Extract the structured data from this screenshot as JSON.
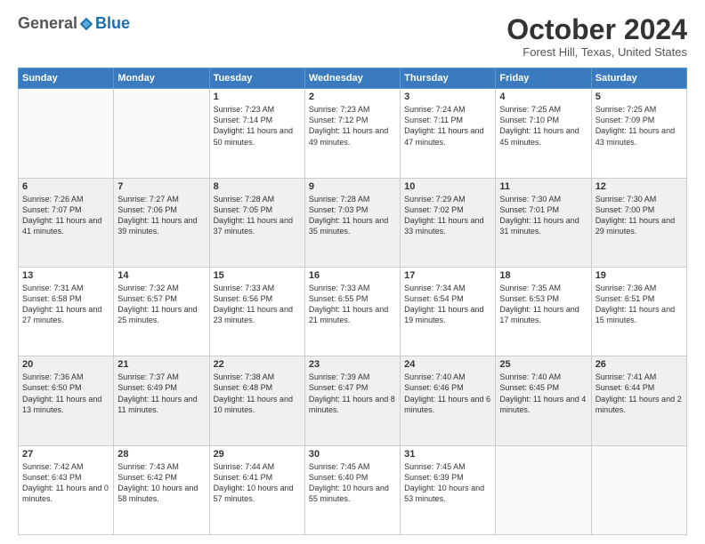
{
  "header": {
    "logo": {
      "general": "General",
      "blue": "Blue"
    },
    "title": "October 2024",
    "location": "Forest Hill, Texas, United States"
  },
  "days_of_week": [
    "Sunday",
    "Monday",
    "Tuesday",
    "Wednesday",
    "Thursday",
    "Friday",
    "Saturday"
  ],
  "weeks": [
    [
      {
        "day": "",
        "empty": true
      },
      {
        "day": "",
        "empty": true
      },
      {
        "day": "1",
        "sunrise": "Sunrise: 7:23 AM",
        "sunset": "Sunset: 7:14 PM",
        "daylight": "Daylight: 11 hours and 50 minutes."
      },
      {
        "day": "2",
        "sunrise": "Sunrise: 7:23 AM",
        "sunset": "Sunset: 7:12 PM",
        "daylight": "Daylight: 11 hours and 49 minutes."
      },
      {
        "day": "3",
        "sunrise": "Sunrise: 7:24 AM",
        "sunset": "Sunset: 7:11 PM",
        "daylight": "Daylight: 11 hours and 47 minutes."
      },
      {
        "day": "4",
        "sunrise": "Sunrise: 7:25 AM",
        "sunset": "Sunset: 7:10 PM",
        "daylight": "Daylight: 11 hours and 45 minutes."
      },
      {
        "day": "5",
        "sunrise": "Sunrise: 7:25 AM",
        "sunset": "Sunset: 7:09 PM",
        "daylight": "Daylight: 11 hours and 43 minutes."
      }
    ],
    [
      {
        "day": "6",
        "sunrise": "Sunrise: 7:26 AM",
        "sunset": "Sunset: 7:07 PM",
        "daylight": "Daylight: 11 hours and 41 minutes."
      },
      {
        "day": "7",
        "sunrise": "Sunrise: 7:27 AM",
        "sunset": "Sunset: 7:06 PM",
        "daylight": "Daylight: 11 hours and 39 minutes."
      },
      {
        "day": "8",
        "sunrise": "Sunrise: 7:28 AM",
        "sunset": "Sunset: 7:05 PM",
        "daylight": "Daylight: 11 hours and 37 minutes."
      },
      {
        "day": "9",
        "sunrise": "Sunrise: 7:28 AM",
        "sunset": "Sunset: 7:03 PM",
        "daylight": "Daylight: 11 hours and 35 minutes."
      },
      {
        "day": "10",
        "sunrise": "Sunrise: 7:29 AM",
        "sunset": "Sunset: 7:02 PM",
        "daylight": "Daylight: 11 hours and 33 minutes."
      },
      {
        "day": "11",
        "sunrise": "Sunrise: 7:30 AM",
        "sunset": "Sunset: 7:01 PM",
        "daylight": "Daylight: 11 hours and 31 minutes."
      },
      {
        "day": "12",
        "sunrise": "Sunrise: 7:30 AM",
        "sunset": "Sunset: 7:00 PM",
        "daylight": "Daylight: 11 hours and 29 minutes."
      }
    ],
    [
      {
        "day": "13",
        "sunrise": "Sunrise: 7:31 AM",
        "sunset": "Sunset: 6:58 PM",
        "daylight": "Daylight: 11 hours and 27 minutes."
      },
      {
        "day": "14",
        "sunrise": "Sunrise: 7:32 AM",
        "sunset": "Sunset: 6:57 PM",
        "daylight": "Daylight: 11 hours and 25 minutes."
      },
      {
        "day": "15",
        "sunrise": "Sunrise: 7:33 AM",
        "sunset": "Sunset: 6:56 PM",
        "daylight": "Daylight: 11 hours and 23 minutes."
      },
      {
        "day": "16",
        "sunrise": "Sunrise: 7:33 AM",
        "sunset": "Sunset: 6:55 PM",
        "daylight": "Daylight: 11 hours and 21 minutes."
      },
      {
        "day": "17",
        "sunrise": "Sunrise: 7:34 AM",
        "sunset": "Sunset: 6:54 PM",
        "daylight": "Daylight: 11 hours and 19 minutes."
      },
      {
        "day": "18",
        "sunrise": "Sunrise: 7:35 AM",
        "sunset": "Sunset: 6:53 PM",
        "daylight": "Daylight: 11 hours and 17 minutes."
      },
      {
        "day": "19",
        "sunrise": "Sunrise: 7:36 AM",
        "sunset": "Sunset: 6:51 PM",
        "daylight": "Daylight: 11 hours and 15 minutes."
      }
    ],
    [
      {
        "day": "20",
        "sunrise": "Sunrise: 7:36 AM",
        "sunset": "Sunset: 6:50 PM",
        "daylight": "Daylight: 11 hours and 13 minutes."
      },
      {
        "day": "21",
        "sunrise": "Sunrise: 7:37 AM",
        "sunset": "Sunset: 6:49 PM",
        "daylight": "Daylight: 11 hours and 11 minutes."
      },
      {
        "day": "22",
        "sunrise": "Sunrise: 7:38 AM",
        "sunset": "Sunset: 6:48 PM",
        "daylight": "Daylight: 11 hours and 10 minutes."
      },
      {
        "day": "23",
        "sunrise": "Sunrise: 7:39 AM",
        "sunset": "Sunset: 6:47 PM",
        "daylight": "Daylight: 11 hours and 8 minutes."
      },
      {
        "day": "24",
        "sunrise": "Sunrise: 7:40 AM",
        "sunset": "Sunset: 6:46 PM",
        "daylight": "Daylight: 11 hours and 6 minutes."
      },
      {
        "day": "25",
        "sunrise": "Sunrise: 7:40 AM",
        "sunset": "Sunset: 6:45 PM",
        "daylight": "Daylight: 11 hours and 4 minutes."
      },
      {
        "day": "26",
        "sunrise": "Sunrise: 7:41 AM",
        "sunset": "Sunset: 6:44 PM",
        "daylight": "Daylight: 11 hours and 2 minutes."
      }
    ],
    [
      {
        "day": "27",
        "sunrise": "Sunrise: 7:42 AM",
        "sunset": "Sunset: 6:43 PM",
        "daylight": "Daylight: 11 hours and 0 minutes."
      },
      {
        "day": "28",
        "sunrise": "Sunrise: 7:43 AM",
        "sunset": "Sunset: 6:42 PM",
        "daylight": "Daylight: 10 hours and 58 minutes."
      },
      {
        "day": "29",
        "sunrise": "Sunrise: 7:44 AM",
        "sunset": "Sunset: 6:41 PM",
        "daylight": "Daylight: 10 hours and 57 minutes."
      },
      {
        "day": "30",
        "sunrise": "Sunrise: 7:45 AM",
        "sunset": "Sunset: 6:40 PM",
        "daylight": "Daylight: 10 hours and 55 minutes."
      },
      {
        "day": "31",
        "sunrise": "Sunrise: 7:45 AM",
        "sunset": "Sunset: 6:39 PM",
        "daylight": "Daylight: 10 hours and 53 minutes."
      },
      {
        "day": "",
        "empty": true
      },
      {
        "day": "",
        "empty": true
      }
    ]
  ]
}
